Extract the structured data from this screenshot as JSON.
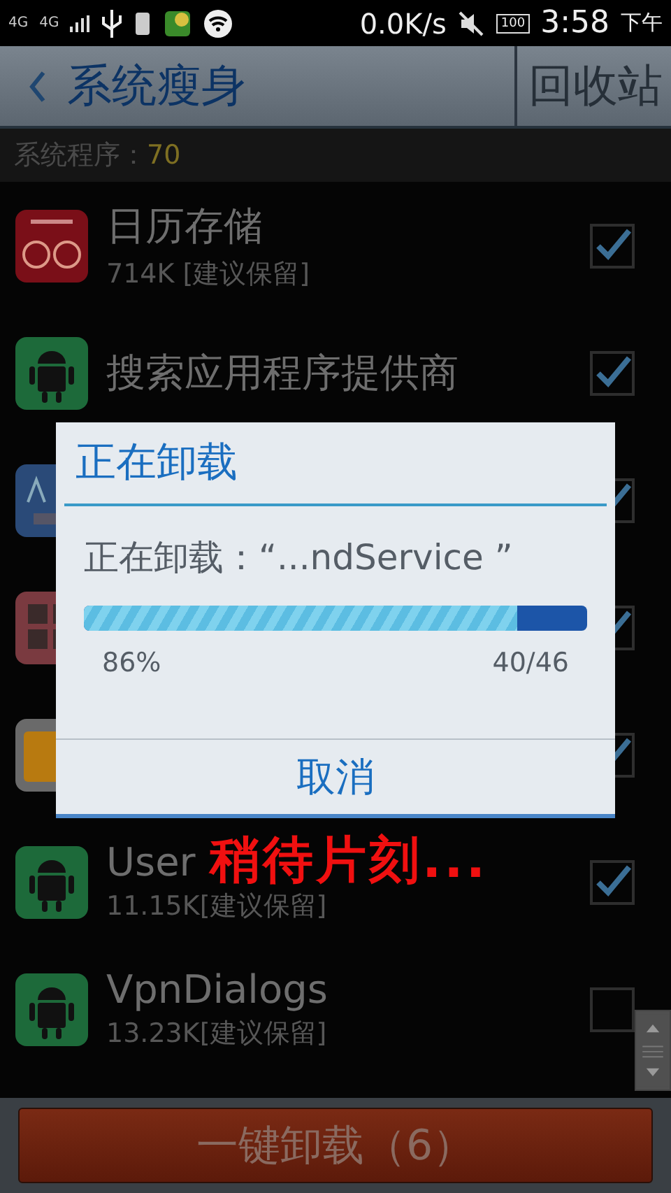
{
  "status_bar": {
    "network_1": "4G",
    "network_2": "4G",
    "speed": "0.0K/s",
    "battery": "100",
    "time": "3:58",
    "period": "下午"
  },
  "header": {
    "title": "系统瘦身",
    "action": "回收站"
  },
  "summary": {
    "label": "系统程序：",
    "count": "70"
  },
  "apps": [
    {
      "kind": "calendar",
      "name": "日历存储",
      "size": "714K [建议保留]",
      "checked": true
    },
    {
      "kind": "android",
      "name": "搜索应用程序提供商",
      "checked": true
    },
    {
      "kind": "keyboard",
      "checked": true
    },
    {
      "kind": "grid",
      "checked": true
    },
    {
      "kind": "folder",
      "checked": true
    },
    {
      "kind": "android",
      "name": "User",
      "size": "11.15K[建议保留]",
      "checked": true
    },
    {
      "kind": "android",
      "name": "VpnDialogs",
      "size": "13.23K[建议保留]",
      "checked": false
    }
  ],
  "dialog": {
    "title": "正在卸载",
    "message": "正在卸载：“...ndService ”",
    "level": 0.86,
    "percent": "86%",
    "count": "40/46",
    "cancel": "取消"
  },
  "annotation": "稍待片刻...",
  "uninstall_button": "一键卸载（6）"
}
